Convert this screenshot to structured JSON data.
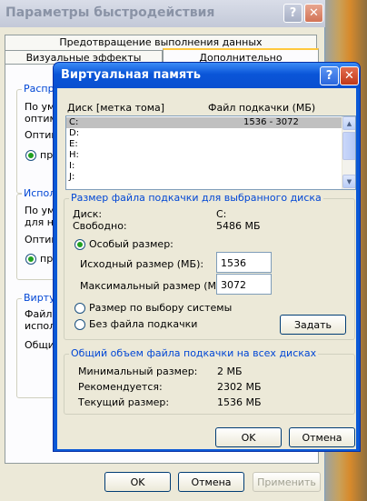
{
  "back_window": {
    "title": "Параметры быстродействия",
    "tabs": [
      "Предотвращение выполнения данных",
      "Визуальные эффекты",
      "Дополнительно"
    ],
    "groups": [
      {
        "title": "Распре",
        "lines": [
          "По умо",
          "оптим"
        ],
        "option_label": "Оптим",
        "radio_label": "про"
      },
      {
        "title": "Испол",
        "lines": [
          "По умо",
          "для на"
        ],
        "option_label": "Оптим",
        "radio_label": "про"
      },
      {
        "title": "Вирту",
        "lines": [
          "Файл п",
          "испол"
        ],
        "option_label": "Общи"
      }
    ],
    "buttons": {
      "ok": "OK",
      "cancel": "Отмена",
      "apply": "Применить"
    }
  },
  "dialog": {
    "title": "Виртуальная память",
    "columns": {
      "drive": "Диск [метка тома]",
      "pagefile": "Файл подкачки (МБ)"
    },
    "drives": [
      {
        "drive": "C:",
        "size": "1536 - 3072",
        "selected": true
      },
      {
        "drive": "D:",
        "size": ""
      },
      {
        "drive": "E:",
        "size": ""
      },
      {
        "drive": "H:",
        "size": ""
      },
      {
        "drive": "I:",
        "size": ""
      },
      {
        "drive": "J:",
        "size": ""
      }
    ],
    "selected_group": {
      "title": "Размер файла подкачки для выбранного диска",
      "disk_label": "Диск:",
      "disk_value": "C:",
      "free_label": "Свободно:",
      "free_value": "5486 МБ",
      "custom_size_label": "Особый размер:",
      "initial_label": "Исходный размер (МБ):",
      "initial_value": "1536",
      "max_label": "Максимальный размер (МБ):",
      "max_value": "3072",
      "system_managed_label": "Размер по выбору системы",
      "no_pagefile_label": "Без файла подкачки",
      "set_button": "Задать",
      "selected_option": "custom"
    },
    "total_group": {
      "title": "Общий объем файла подкачки на всех дисках",
      "min_label": "Минимальный размер:",
      "min_value": "2 МБ",
      "recommended_label": "Рекомендуется:",
      "recommended_value": "2302 МБ",
      "current_label": "Текущий размер:",
      "current_value": "1536 МБ"
    },
    "buttons": {
      "ok": "OK",
      "cancel": "Отмена"
    }
  },
  "colors": {
    "title_blue": "#0a55d8",
    "group_title": "#0046d5",
    "dialog_face": "#ece9d8",
    "radio_dot": "#21a121"
  },
  "icons": [
    "help-icon",
    "close-icon",
    "scroll-up-icon",
    "scroll-down-icon"
  ]
}
